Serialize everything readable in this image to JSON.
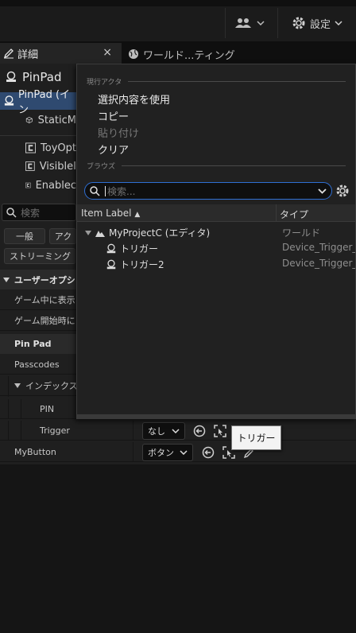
{
  "topbar": {
    "users_icon": "users-icon",
    "settings_label": "設定"
  },
  "tabs": [
    {
      "label": "詳細",
      "icon": "pencil-icon",
      "close": "×"
    },
    {
      "label": "ワールド...ティング",
      "icon": "globe-icon"
    }
  ],
  "details": {
    "object_title": "PinPad",
    "components": [
      {
        "label": "PinPad (イン"
      },
      {
        "label": "StaticM"
      },
      {
        "label": "ToyOpt"
      },
      {
        "label": "VisibleI"
      },
      {
        "label": "Enablec"
      }
    ],
    "search_placeholder": "検索",
    "categories": [
      "一般",
      "アク",
      "ストリーミング"
    ],
    "sections": {
      "user_options": "ユーザーオプショ",
      "pin_pad": "Pin Pad"
    },
    "rows": {
      "show_in_game": "ゲーム中に表示",
      "game_start": "ゲーム開始時に",
      "passcodes": "Passcodes",
      "index": "インデックス",
      "pin": "PIN",
      "trigger": "Trigger",
      "my_button": "MyButton"
    },
    "trigger_value": "なし",
    "button_value": "ボタン"
  },
  "tooltip": "トリガー",
  "dropdown": {
    "current_actor_header": "現行アクタ",
    "menu": [
      "選択内容を使用",
      "コピー",
      "貼り付け",
      "クリア"
    ],
    "browse_header": "ブラウズ",
    "search_placeholder": "検索...",
    "columns": {
      "label": "Item Label",
      "sort_indicator": "▲",
      "type": "タイプ"
    },
    "items": [
      {
        "name": "MyProjectC (エディタ)",
        "type": "ワールド"
      },
      {
        "name": "トリガー",
        "type": "Device_Trigger_"
      },
      {
        "name": "トリガー2",
        "type": "Device_Trigger_"
      }
    ]
  },
  "colors": {
    "accent_blue": "#2f6fd3",
    "selection": "#2f4a70",
    "panel_bg": "#1f1f1f"
  }
}
